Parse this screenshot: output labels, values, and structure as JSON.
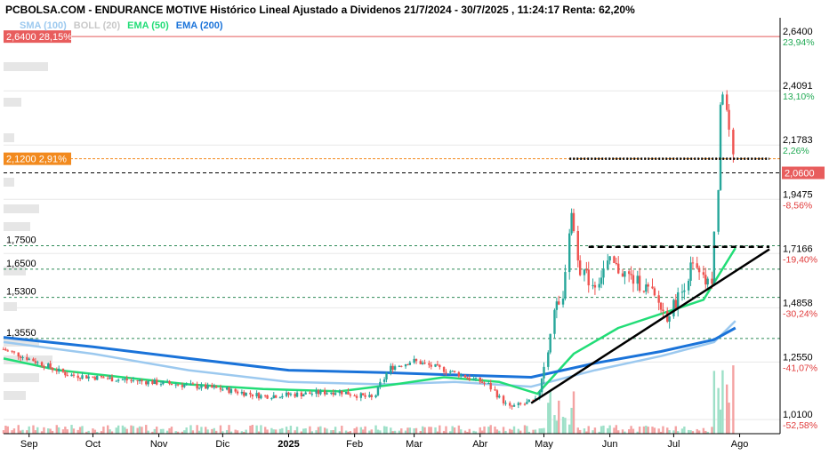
{
  "title": "PCBOLSA.COM - ENDURANCE MOTIVE Histórico Lineal Ajustado a Dividenos 21/7/2024 - 30/7/2025 , 11:24:17 Renta: 62,20%",
  "legend": [
    {
      "label": "SMA (100)",
      "color": "#9cc9ef"
    },
    {
      "label": "BOLL (20)",
      "color": "#c8c8c8"
    },
    {
      "label": "EMA (50)",
      "color": "#22dd77"
    },
    {
      "label": "EMA (200)",
      "color": "#1a73d9"
    }
  ],
  "price_tags": {
    "high": {
      "value": "2,6400",
      "pct": "28,15%",
      "color": "#e85d5d"
    },
    "mid": {
      "value": "2,1200",
      "pct": "2,91%",
      "color": "#f28a1e"
    },
    "last": {
      "value": "2,0600",
      "color": "#e85d5d"
    }
  },
  "right_axis": [
    {
      "value": "2,6400",
      "pct": "23,94%",
      "pct_color": "#22aa55"
    },
    {
      "value": "2,4091",
      "pct": "13,10%",
      "pct_color": "#22aa55"
    },
    {
      "value": "2,1783",
      "pct": "2,26%",
      "pct_color": "#22aa55"
    },
    {
      "value": "1,9475",
      "pct": "-8,56%",
      "pct_color": "#e03a3a"
    },
    {
      "value": "1,7166",
      "pct": "-19,40%",
      "pct_color": "#e03a3a"
    },
    {
      "value": "1,4858",
      "pct": "-30,24%",
      "pct_color": "#e03a3a"
    },
    {
      "value": "1,2550",
      "pct": "-41,07%",
      "pct_color": "#e03a3a"
    },
    {
      "value": "1,0100",
      "pct": "-52,58%",
      "pct_color": "#e03a3a"
    }
  ],
  "support_levels": [
    "1,7500",
    "1,6500",
    "1,5300",
    "1,3550"
  ],
  "x_axis": [
    "Sep",
    "Oct",
    "Nov",
    "Dic",
    "2025",
    "Feb",
    "Mar",
    "Abr",
    "May",
    "Jun",
    "Jul",
    "Ago"
  ],
  "colors": {
    "up": "#26a69a",
    "down": "#ef5350",
    "grid": "#e8e8e8"
  },
  "chart_data": {
    "type": "line",
    "y_range": [
      0.95,
      2.72
    ],
    "x_range": [
      "2024-08-20",
      "2025-08-20"
    ],
    "resistance": [
      2.12,
      1.745
    ],
    "trendline": [
      {
        "x": "2025-04-25",
        "y": 1.08
      },
      {
        "x": "2025-08-15",
        "y": 1.735
      }
    ],
    "price": [
      {
        "x": "2024-08-20",
        "y": 1.31
      },
      {
        "x": "2024-09-01",
        "y": 1.27
      },
      {
        "x": "2024-09-20",
        "y": 1.2
      },
      {
        "x": "2024-10-15",
        "y": 1.18
      },
      {
        "x": "2024-11-10",
        "y": 1.16
      },
      {
        "x": "2024-12-01",
        "y": 1.14
      },
      {
        "x": "2024-12-20",
        "y": 1.11
      },
      {
        "x": "2025-01-10",
        "y": 1.12
      },
      {
        "x": "2025-01-25",
        "y": 1.13
      },
      {
        "x": "2025-02-10",
        "y": 1.1
      },
      {
        "x": "2025-02-18",
        "y": 1.23
      },
      {
        "x": "2025-03-01",
        "y": 1.26
      },
      {
        "x": "2025-03-20",
        "y": 1.21
      },
      {
        "x": "2025-04-05",
        "y": 1.16
      },
      {
        "x": "2025-04-15",
        "y": 1.06
      },
      {
        "x": "2025-04-28",
        "y": 1.09
      },
      {
        "x": "2025-05-03",
        "y": 1.3
      },
      {
        "x": "2025-05-06",
        "y": 1.48
      },
      {
        "x": "2025-05-10",
        "y": 1.49
      },
      {
        "x": "2025-05-14",
        "y": 1.92
      },
      {
        "x": "2025-05-18",
        "y": 1.66
      },
      {
        "x": "2025-05-25",
        "y": 1.58
      },
      {
        "x": "2025-06-01",
        "y": 1.68
      },
      {
        "x": "2025-06-10",
        "y": 1.62
      },
      {
        "x": "2025-06-20",
        "y": 1.56
      },
      {
        "x": "2025-06-28",
        "y": 1.45
      },
      {
        "x": "2025-07-05",
        "y": 1.55
      },
      {
        "x": "2025-07-10",
        "y": 1.67
      },
      {
        "x": "2025-07-15",
        "y": 1.6
      },
      {
        "x": "2025-07-19",
        "y": 1.58
      },
      {
        "x": "2025-07-22",
        "y": 2.0
      },
      {
        "x": "2025-07-24",
        "y": 2.46
      },
      {
        "x": "2025-07-26",
        "y": 2.34
      },
      {
        "x": "2025-07-28",
        "y": 2.2
      },
      {
        "x": "2025-07-30",
        "y": 2.06
      }
    ],
    "series": [
      {
        "name": "SMA (100)",
        "color": "#9cc9ef",
        "points": [
          {
            "x": "2024-08-20",
            "y": 1.34
          },
          {
            "x": "2024-10-01",
            "y": 1.29
          },
          {
            "x": "2024-11-15",
            "y": 1.22
          },
          {
            "x": "2025-01-01",
            "y": 1.17
          },
          {
            "x": "2025-02-15",
            "y": 1.16
          },
          {
            "x": "2025-03-20",
            "y": 1.17
          },
          {
            "x": "2025-04-25",
            "y": 1.15
          },
          {
            "x": "2025-05-25",
            "y": 1.22
          },
          {
            "x": "2025-06-25",
            "y": 1.28
          },
          {
            "x": "2025-07-20",
            "y": 1.34
          },
          {
            "x": "2025-07-30",
            "y": 1.43
          }
        ]
      },
      {
        "name": "EMA (50)",
        "color": "#22dd77",
        "points": [
          {
            "x": "2024-08-20",
            "y": 1.27
          },
          {
            "x": "2024-09-15",
            "y": 1.22
          },
          {
            "x": "2024-10-15",
            "y": 1.19
          },
          {
            "x": "2024-11-15",
            "y": 1.16
          },
          {
            "x": "2024-12-20",
            "y": 1.14
          },
          {
            "x": "2025-01-25",
            "y": 1.13
          },
          {
            "x": "2025-02-20",
            "y": 1.16
          },
          {
            "x": "2025-03-15",
            "y": 1.19
          },
          {
            "x": "2025-04-10",
            "y": 1.17
          },
          {
            "x": "2025-04-28",
            "y": 1.12
          },
          {
            "x": "2025-05-15",
            "y": 1.29
          },
          {
            "x": "2025-06-05",
            "y": 1.4
          },
          {
            "x": "2025-06-25",
            "y": 1.46
          },
          {
            "x": "2025-07-15",
            "y": 1.52
          },
          {
            "x": "2025-07-30",
            "y": 1.74
          }
        ]
      },
      {
        "name": "EMA (200)",
        "color": "#1a73d9",
        "points": [
          {
            "x": "2024-08-20",
            "y": 1.36
          },
          {
            "x": "2024-10-01",
            "y": 1.32
          },
          {
            "x": "2024-11-15",
            "y": 1.27
          },
          {
            "x": "2025-01-01",
            "y": 1.22
          },
          {
            "x": "2025-02-15",
            "y": 1.21
          },
          {
            "x": "2025-03-20",
            "y": 1.2
          },
          {
            "x": "2025-04-25",
            "y": 1.19
          },
          {
            "x": "2025-05-25",
            "y": 1.25
          },
          {
            "x": "2025-06-25",
            "y": 1.3
          },
          {
            "x": "2025-07-20",
            "y": 1.35
          },
          {
            "x": "2025-07-30",
            "y": 1.4
          }
        ]
      }
    ]
  }
}
